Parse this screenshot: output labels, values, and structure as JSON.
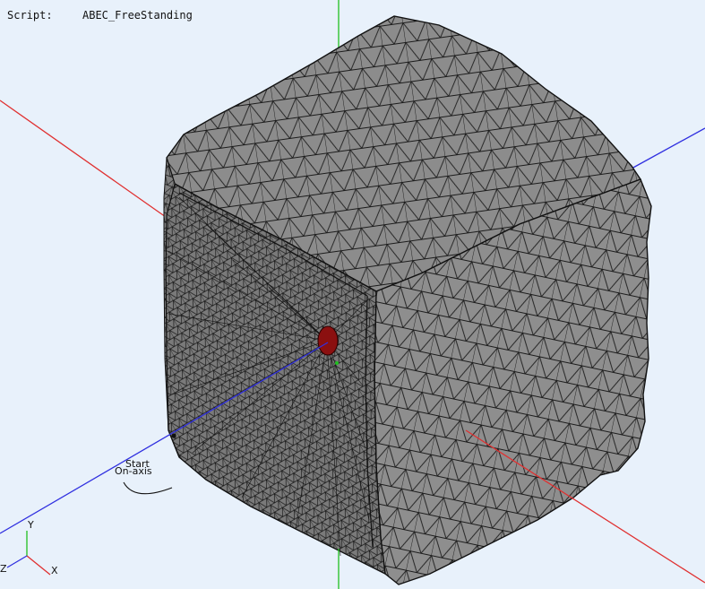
{
  "header": {
    "script_label": "Script:",
    "script_value": "ABEC_FreeStanding"
  },
  "annotation": {
    "start": "Start",
    "onaxis": "On-axis"
  },
  "triad": {
    "y": "Y",
    "x": "X",
    "z": "Z"
  },
  "colors": {
    "background": "#e8f1fb",
    "mesh_fill": "#8a8a8a",
    "mesh_edges": "#1a1a1a",
    "axis_x": "#e03030",
    "axis_y": "#20c020",
    "axis_z": "#3030e0",
    "driver": "#8b1010"
  },
  "icons": [
    "axis-triad-icon"
  ]
}
